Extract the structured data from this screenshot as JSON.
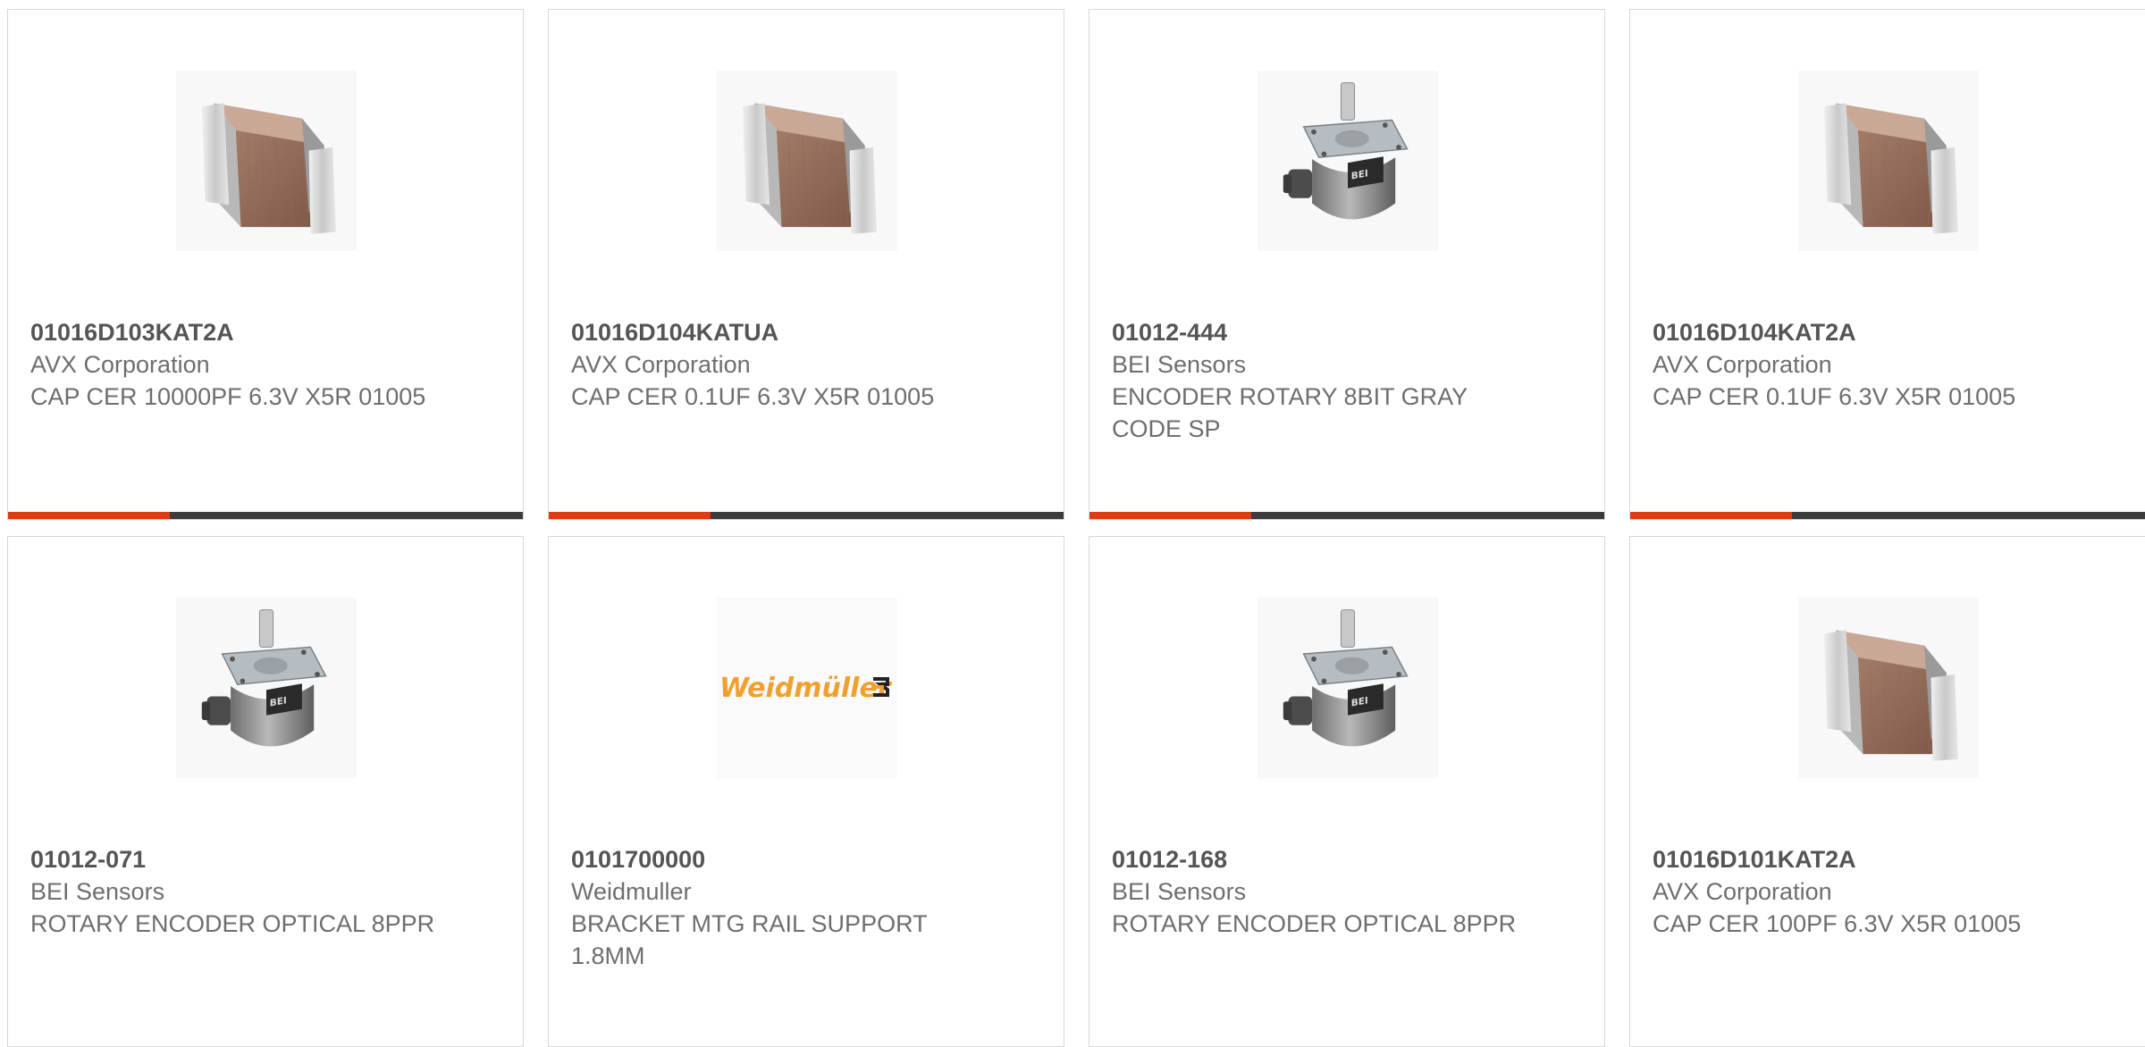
{
  "products": [
    {
      "part": "01016D103KAT2A",
      "manufacturer": "AVX Corporation",
      "description": "CAP CER 10000PF 6.3V X5R 01005",
      "image": "ceramic-capacitor-icon"
    },
    {
      "part": "01016D104KATUA",
      "manufacturer": "AVX Corporation",
      "description": "CAP CER 0.1UF 6.3V X5R 01005",
      "image": "ceramic-capacitor-icon"
    },
    {
      "part": "01012-444",
      "manufacturer": "BEI Sensors",
      "description": "ENCODER ROTARY 8BIT GRAY CODE SP",
      "image": "rotary-encoder-icon"
    },
    {
      "part": "01016D104KAT2A",
      "manufacturer": "AVX Corporation",
      "description": "CAP CER 0.1UF 6.3V X5R 01005",
      "image": "ceramic-capacitor-icon"
    },
    {
      "part": "01012-071",
      "manufacturer": "BEI Sensors",
      "description": "ROTARY ENCODER OPTICAL 8PPR",
      "image": "rotary-encoder-icon"
    },
    {
      "part": "0101700000",
      "manufacturer": "Weidmuller",
      "description": "BRACKET MTG RAIL SUPPORT 1.8MM",
      "image": "weidmuller-logo",
      "logo_text": "Weidmüller"
    },
    {
      "part": "01012-168",
      "manufacturer": "BEI Sensors",
      "description": "ROTARY ENCODER OPTICAL 8PPR",
      "image": "rotary-encoder-icon"
    },
    {
      "part": "01016D101KAT2A",
      "manufacturer": "AVX Corporation",
      "description": "CAP CER 100PF 6.3V X5R 01005",
      "image": "ceramic-capacitor-icon"
    }
  ],
  "colors": {
    "accent": "#e23a12",
    "bar": "#3c3c3c",
    "part_text": "#555555",
    "body_text": "#6e6e6e",
    "logo": "#f0a030"
  },
  "progress_fraction": 0.315
}
